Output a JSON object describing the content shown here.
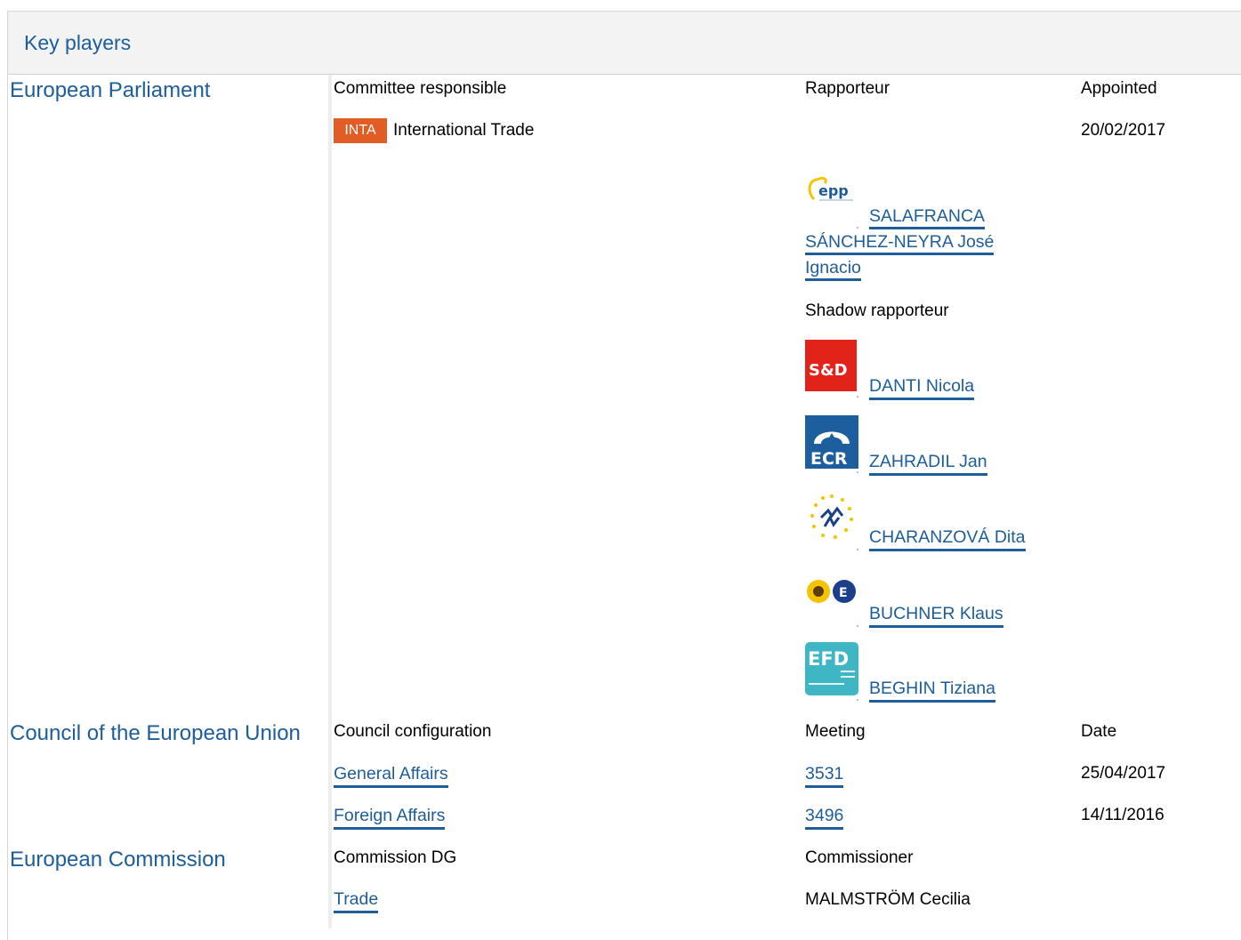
{
  "header": {
    "title": "Key players"
  },
  "parliament": {
    "title": "European Parliament",
    "col_committee": "Committee responsible",
    "col_rapporteur": "Rapporteur",
    "col_appointed": "Appointed",
    "committee_code": "INTA",
    "committee_name": "International Trade",
    "appointed_date": "20/02/2017",
    "rapporteur": {
      "line1": "SALAFRANCA",
      "line2": "SÁNCHEZ-NEYRA José",
      "line3": "Ignacio",
      "group_icon": "epp-logo-icon"
    },
    "shadow_label": "Shadow rapporteur",
    "shadows": [
      {
        "name": "DANTI Nicola",
        "group_icon": "sd-logo-icon",
        "group_text": "S&D",
        "color": "#e2231a"
      },
      {
        "name": "ZAHRADIL Jan",
        "group_icon": "ecr-logo-icon",
        "group_text": "ECR",
        "color": "#1c5e9e"
      },
      {
        "name": "CHARANZOVÁ Dita",
        "group_icon": "alde-logo-icon"
      },
      {
        "name": "BUCHNER Klaus",
        "group_icon": "greens-efa-logo-icon"
      },
      {
        "name": "BEGHIN Tiziana",
        "group_icon": "efdd-logo-icon",
        "group_text": "EFD",
        "color": "#3fb6c4"
      }
    ]
  },
  "council": {
    "title": "Council of the European Union",
    "col_config": "Council configuration",
    "col_meeting": "Meeting",
    "col_date": "Date",
    "rows": [
      {
        "config": "General Affairs",
        "meeting": "3531",
        "date": "25/04/2017"
      },
      {
        "config": "Foreign Affairs",
        "meeting": "3496",
        "date": "14/11/2016"
      }
    ]
  },
  "commission": {
    "title": "European Commission",
    "col_dg": "Commission DG",
    "col_commissioner": "Commissioner",
    "dg": "Trade",
    "commissioner": "MALMSTRÖM Cecilia"
  }
}
